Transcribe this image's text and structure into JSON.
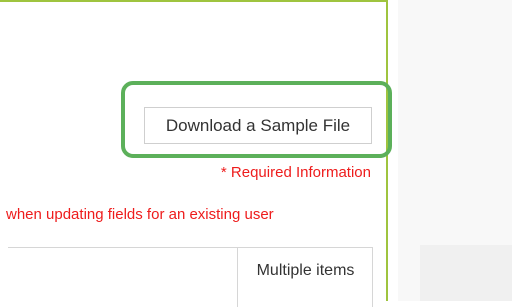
{
  "toolbar": {
    "download_button_label": "Download a Sample File"
  },
  "notes": {
    "required": "* Required Information",
    "update_hint": "when updating fields for an existing user"
  },
  "table": {
    "column_headers": [
      "Multiple items"
    ]
  },
  "colors": {
    "highlight": "#5cb05a",
    "panel_border": "#9fc43f",
    "required_text": "#ee1c1c"
  }
}
